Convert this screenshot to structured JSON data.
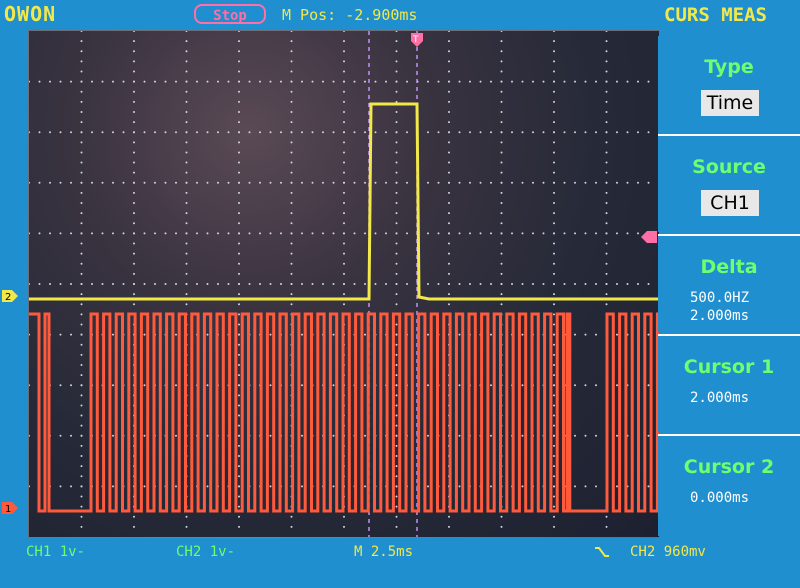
{
  "header": {
    "brand": "OWON",
    "run_state": "Stop",
    "m_pos": "M Pos: -2.900ms",
    "menu_title": "CURS MEAS"
  },
  "panels": {
    "type": {
      "title": "Type",
      "value": "Time"
    },
    "source": {
      "title": "Source",
      "value": "CH1"
    },
    "delta": {
      "title": "Delta",
      "freq": "500.0HZ",
      "time": "2.000ms"
    },
    "cursor1": {
      "title": "Cursor 1",
      "value": "2.000ms"
    },
    "cursor2": {
      "title": "Cursor 2",
      "value": "0.000ms"
    }
  },
  "footer": {
    "ch1": "CH1 1v-",
    "ch2": "CH2 1v-",
    "timebase": "M 2.5ms",
    "trigger": "CH2 960mv"
  },
  "colors": {
    "ch1_trace": "#f2e84a",
    "ch2_trace": "#ff5a3c",
    "cursor": "#c79bff",
    "background": "#1f8fd0"
  },
  "waveforms": {
    "ch1": "single positive pulse",
    "ch2": "square pulse train with low gaps at left and right"
  }
}
